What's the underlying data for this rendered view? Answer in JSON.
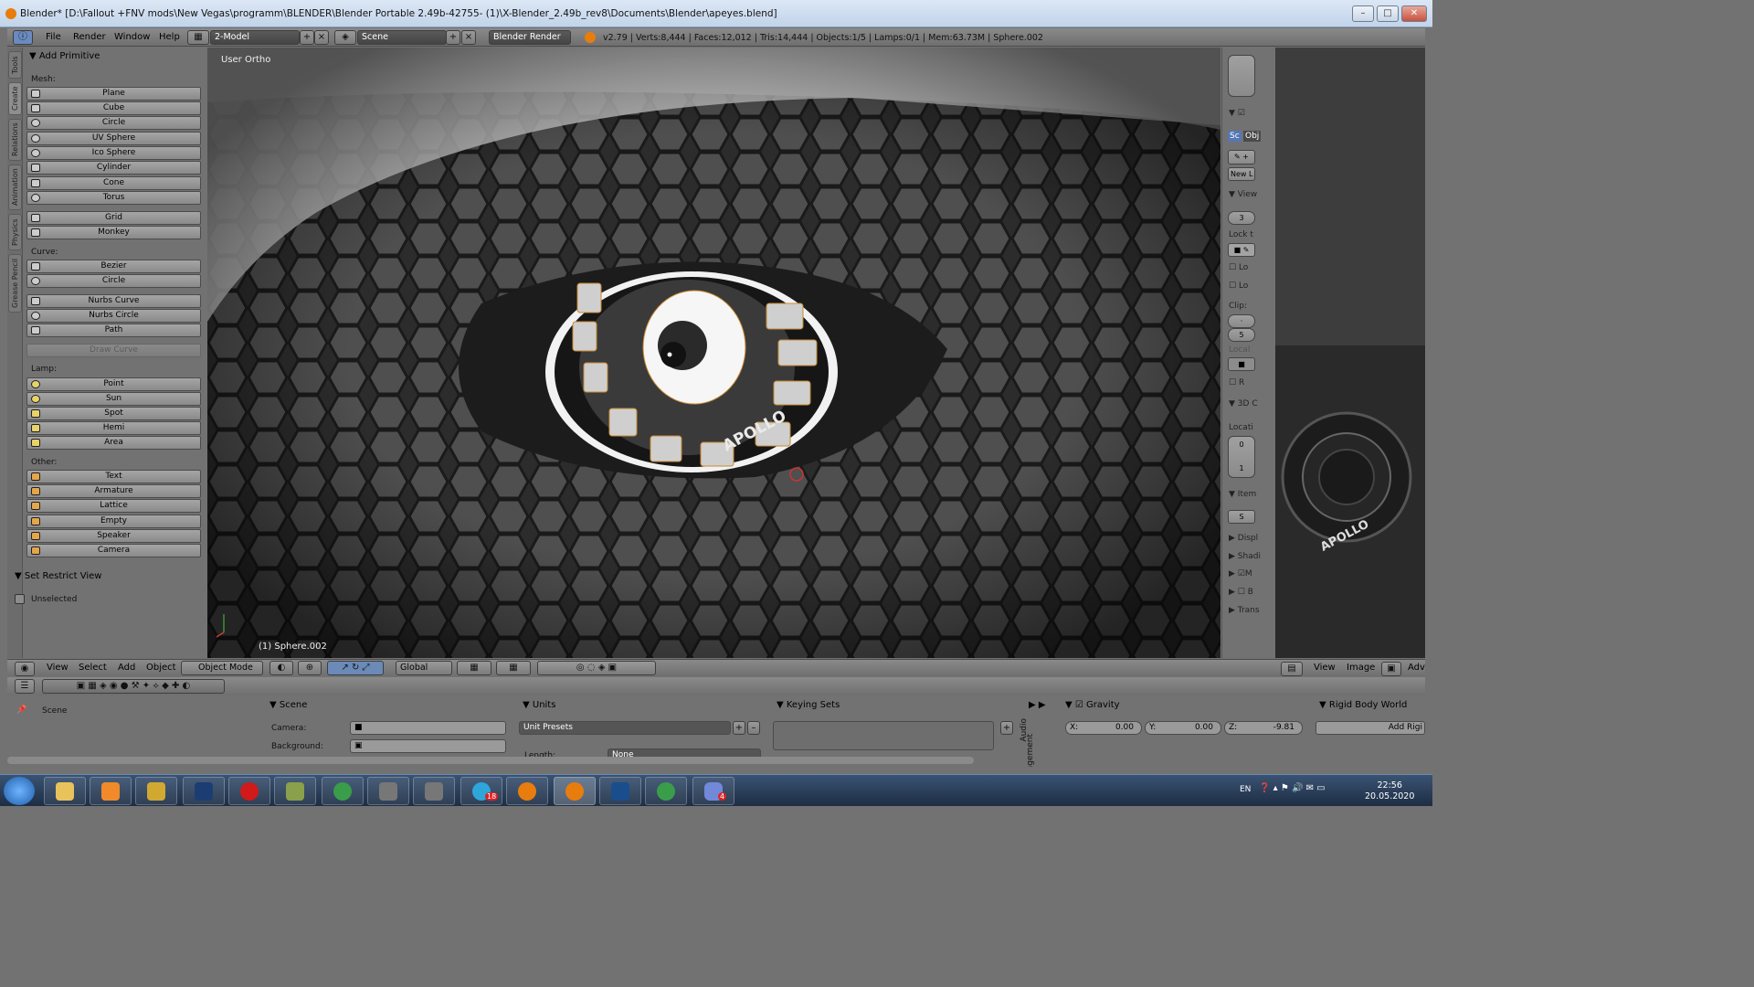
{
  "window": {
    "title": "Blender* [D:\\Fallout +FNV mods\\New Vegas\\programm\\BLENDER\\Blender Portable 2.49b-42755- (1)\\X-Blender_2.49b_rev8\\Documents\\Blender\\apeyes.blend]",
    "min": "–",
    "max": "□",
    "close": "✕"
  },
  "header": {
    "menus": [
      "File",
      "Render",
      "Window",
      "Help"
    ],
    "layout": "2-Model",
    "scene": "Scene",
    "engine": "Blender Render",
    "stats": "v2.79 | Verts:8,444 | Faces:12,012 | Tris:14,444 | Objects:1/5 | Lamps:0/1 | Mem:63.73M | Sphere.002"
  },
  "tabs": [
    "Tools",
    "Create",
    "Relations",
    "Animation",
    "Physics",
    "Grease Pencil"
  ],
  "tools": {
    "title": "Add Primitive",
    "mesh_label": "Mesh:",
    "mesh": [
      "Plane",
      "Cube",
      "Circle",
      "UV Sphere",
      "Ico Sphere",
      "Cylinder",
      "Cone",
      "Torus"
    ],
    "mesh2": [
      "Grid",
      "Monkey"
    ],
    "curve_label": "Curve:",
    "curve": [
      "Bezier",
      "Circle"
    ],
    "curve2": [
      "Nurbs Curve",
      "Nurbs Circle",
      "Path"
    ],
    "draw_curve": "Draw Curve",
    "lamp_label": "Lamp:",
    "lamp": [
      "Point",
      "Sun",
      "Spot",
      "Hemi",
      "Area"
    ],
    "other_label": "Other:",
    "other": [
      "Text",
      "Armature",
      "Lattice",
      "Empty",
      "Speaker",
      "Camera"
    ],
    "restrict_title": "Set Restrict View",
    "unselected": "Unselected"
  },
  "viewport": {
    "label": "User Ortho",
    "object": "(1) Sphere.002",
    "brand": "APOLLO"
  },
  "npanel": {
    "items": [
      "Lock t",
      "Lo",
      "Lo",
      "Clip:",
      "Local",
      "R",
      "3D C",
      "Locati",
      "Item",
      "Displ",
      "Shadi",
      "M",
      "B",
      "Trans",
      "View",
      "New L",
      "Sc",
      "Obj"
    ],
    "vals": [
      "3",
      "5",
      "0",
      "1",
      "S"
    ]
  },
  "vphead": {
    "menus": [
      "View",
      "Select",
      "Add",
      "Object"
    ],
    "mode": "Object Mode",
    "orient": "Global"
  },
  "imghead": {
    "menus": [
      "View",
      "Image"
    ],
    "adv": "Adv"
  },
  "props": {
    "scene_path": "Scene",
    "scene_title": "Scene",
    "camera": "Camera:",
    "background": "Background:",
    "units_title": "Units",
    "unit_presets": "Unit Presets",
    "length": "Length:",
    "length_val": "None",
    "keying_title": "Keying Sets",
    "gravity_title": "Gravity",
    "gx": "X:",
    "gx_val": "0.00",
    "gy": "Y:",
    "gy_val": "0.00",
    "gz": "Z:",
    "gz_val": "-9.81",
    "rigid_title": "Rigid Body World",
    "add_rigid": "Add Rigi",
    "audio": "Audio",
    "management": "agement"
  },
  "taskbar": {
    "lang": "EN",
    "time": "22:56",
    "date": "20.05.2020",
    "badges": [
      "18",
      "4"
    ]
  }
}
